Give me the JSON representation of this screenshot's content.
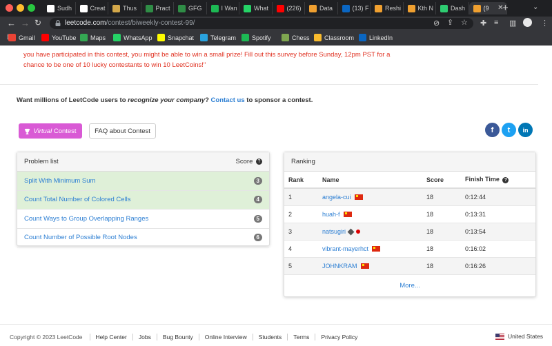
{
  "browser": {
    "tabs": [
      {
        "label": "Sudh",
        "color": "#ffffff"
      },
      {
        "label": "Creat",
        "color": "#ffffff"
      },
      {
        "label": "Thus",
        "color": "#d4a84a"
      },
      {
        "label": "Pract",
        "color": "#2f8d46"
      },
      {
        "label": "GFG",
        "color": "#2f8d46"
      },
      {
        "label": "I Wan",
        "color": "#1db954"
      },
      {
        "label": "What",
        "color": "#25d366"
      },
      {
        "label": "(226)",
        "color": "#ff0000"
      },
      {
        "label": "Data",
        "color": "#f0a030"
      },
      {
        "label": "(13) F",
        "color": "#0a66c2"
      },
      {
        "label": "Reshi",
        "color": "#f0a030"
      },
      {
        "label": "Kth N",
        "color": "#f0a030"
      },
      {
        "label": "Dash",
        "color": "#2ecc71"
      },
      {
        "label": "(9",
        "color": "#f0a030",
        "active": true
      }
    ],
    "url_domain": "leetcode.com",
    "url_path": "/contest/biweekly-contest-99/",
    "bookmarks": [
      {
        "label": "Gmail",
        "color": "#ea4335"
      },
      {
        "label": "YouTube",
        "color": "#ff0000"
      },
      {
        "label": "Maps",
        "color": "#34a853"
      },
      {
        "label": "WhatsApp",
        "color": "#25d366"
      },
      {
        "label": "Snapchat",
        "color": "#fffc00"
      },
      {
        "label": "Telegram",
        "color": "#2aa3df"
      },
      {
        "label": "Spotify",
        "color": "#1db954"
      },
      {
        "label": "Chess",
        "color": "#7fa650"
      },
      {
        "label": "Classroom",
        "color": "#f9bb2d"
      },
      {
        "label": "LinkedIn",
        "color": "#0a66c2"
      }
    ]
  },
  "notice": {
    "line1": "you have participated in this contest, you might be able to win a small prize! Fill out this survey before Sunday, 12pm PST for a",
    "line2": "chance to be one of 10 lucky contestants to win 10 LeetCoins!\""
  },
  "sponsor": {
    "prefix": "Want millions of LeetCode users to ",
    "italic": "recognize your company",
    "mid": "? ",
    "link": "Contact us",
    "suffix": " to sponsor a contest."
  },
  "buttons": {
    "virtual_italic": "Virtual",
    "virtual_rest": " Contest",
    "faq": "FAQ about Contest"
  },
  "social": {
    "facebook": "f",
    "twitter": "t",
    "linkedin": "in"
  },
  "problems": {
    "title": "Problem list",
    "score_header": "Score",
    "items": [
      {
        "name": "Split With Minimum Sum",
        "score": "3",
        "solved": true
      },
      {
        "name": "Count Total Number of Colored Cells",
        "score": "4",
        "solved": true
      },
      {
        "name": "Count Ways to Group Overlapping Ranges",
        "score": "5",
        "solved": false
      },
      {
        "name": "Count Number of Possible Root Nodes",
        "score": "6",
        "solved": false
      }
    ]
  },
  "ranking": {
    "title": "Ranking",
    "headers": {
      "rank": "Rank",
      "name": "Name",
      "score": "Score",
      "finish": "Finish Time"
    },
    "rows": [
      {
        "rank": "1",
        "name": "angela-cui",
        "score": "18",
        "finish": "0:12:44",
        "flag": "cn"
      },
      {
        "rank": "2",
        "name": "huah-f",
        "score": "18",
        "finish": "0:13:31",
        "flag": "cn"
      },
      {
        "rank": "3",
        "name": "natsugiri",
        "score": "18",
        "finish": "0:13:54",
        "flag": "jp"
      },
      {
        "rank": "4",
        "name": "vibrant-mayerhct",
        "score": "18",
        "finish": "0:16:02",
        "flag": "cn"
      },
      {
        "rank": "5",
        "name": "JOHNKRAM",
        "score": "18",
        "finish": "0:16:26",
        "flag": "cn"
      }
    ],
    "more": "More..."
  },
  "footer": {
    "copyright": "Copyright © 2023 LeetCode",
    "links": [
      "Help Center",
      "Jobs",
      "Bug Bounty",
      "Online Interview",
      "Students",
      "Terms",
      "Privacy Policy"
    ],
    "region": "United States"
  }
}
